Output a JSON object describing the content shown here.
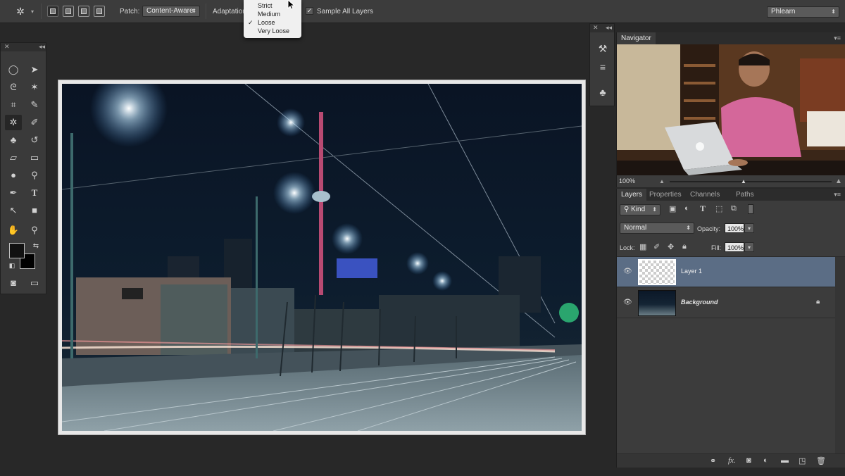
{
  "options_bar": {
    "patch_label": "Patch:",
    "patch_value": "Content-Aware",
    "adaptation_label": "Adaptation",
    "sample_all_layers_label": "Sample All Layers",
    "sample_all_layers_checked": true,
    "workspace_value": "Phlearn"
  },
  "adaptation_menu": {
    "items": [
      "Strict",
      "Medium",
      "Loose",
      "Very Loose"
    ],
    "checked": "Loose",
    "check_mark": "✓"
  },
  "navigator": {
    "tab_label": "Navigator",
    "zoom_value": "100%"
  },
  "layers_panel": {
    "tabs": [
      "Layers",
      "Properties",
      "Channels",
      "Paths"
    ],
    "filter_value": "Kind",
    "blend_mode": "Normal",
    "opacity_label": "Opacity:",
    "opacity_value": "100%",
    "lock_label": "Lock:",
    "fill_label": "Fill:",
    "fill_value": "100%",
    "layers": [
      {
        "name": "Layer 1",
        "selected": true
      },
      {
        "name": "Background",
        "selected": false,
        "locked": true
      }
    ],
    "bottom_icons": [
      "link-icon",
      "fx-icon",
      "mask-icon",
      "adjustment-icon",
      "folder-icon",
      "new-layer-icon",
      "trash-icon"
    ],
    "fx_glyph": "fx."
  },
  "colors": {
    "selected_layer": "#5b6d85",
    "panel_bg": "#3c3c3c",
    "menu_bg": "#f0f0f0"
  }
}
